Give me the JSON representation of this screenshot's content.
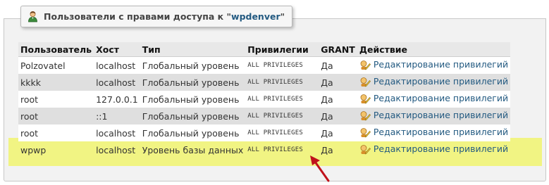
{
  "legend": {
    "title_prefix": "Пользователи с правами доступа к \"",
    "db_name": "wpdenver",
    "title_suffix": "\"",
    "icon": "users-icon"
  },
  "table": {
    "headers": [
      "Пользователь",
      "Хост",
      "Тип",
      "Привилегии",
      "GRANT",
      "Действие"
    ],
    "rows": [
      {
        "user": "Polzovatel",
        "host": "localhost",
        "type": "Глобальный уровень",
        "privileges": "ALL PRIVILEGES",
        "grant": "Да",
        "action": "Редактирование привилегий"
      },
      {
        "user": "kkkk",
        "host": "localhost",
        "type": "Глобальный уровень",
        "privileges": "ALL PRIVILEGES",
        "grant": "Да",
        "action": "Редактирование привилегий"
      },
      {
        "user": "root",
        "host": "127.0.0.1",
        "type": "Глобальный уровень",
        "privileges": "ALL PRIVILEGES",
        "grant": "Да",
        "action": "Редактирование привилегий"
      },
      {
        "user": "root",
        "host": "::1",
        "type": "Глобальный уровень",
        "privileges": "ALL PRIVILEGES",
        "grant": "Да",
        "action": "Редактирование привилегий"
      },
      {
        "user": "root",
        "host": "localhost",
        "type": "Глобальный уровень",
        "privileges": "ALL PRIVILEGES",
        "grant": "Да",
        "action": "Редактирование привилегий"
      },
      {
        "user": "wpwp",
        "host": "localhost",
        "type": "Уровень базы данных",
        "privileges": "ALL PRIVILEGES",
        "grant": "Да",
        "action": "Редактирование привилегий"
      }
    ],
    "action_icon": "edit-privileges-icon"
  },
  "colors": {
    "link": "#235a81",
    "highlight": "#f1f483",
    "arrow": "#c0121b",
    "even_row": "#dfdfdf",
    "header_bg": "#e8e8e8"
  }
}
